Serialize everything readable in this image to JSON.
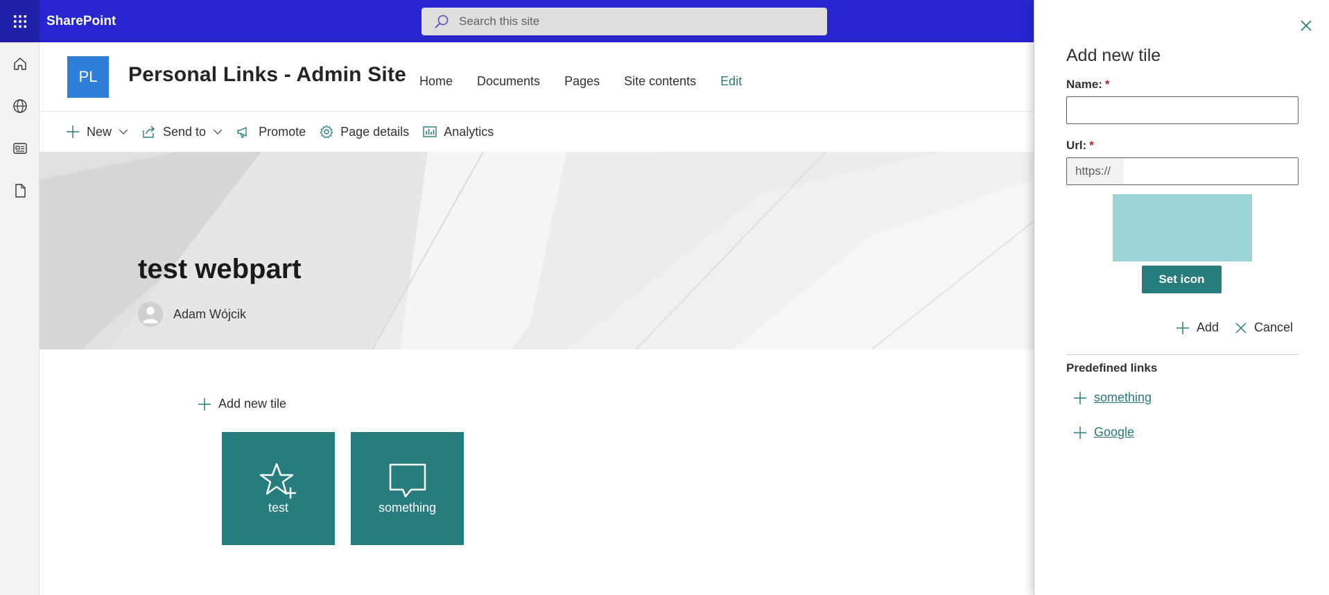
{
  "suitebar": {
    "brand": "SharePoint",
    "search_placeholder": "Search this site"
  },
  "site": {
    "logo_initials": "PL",
    "title": "Personal Links - Admin Site",
    "nav": [
      "Home",
      "Documents",
      "Pages",
      "Site contents",
      "Edit"
    ]
  },
  "commandbar": {
    "new": "New",
    "send_to": "Send to",
    "promote": "Promote",
    "page_details": "Page details",
    "analytics": "Analytics"
  },
  "hero": {
    "page_title": "test webpart",
    "author": "Adam Wójcik"
  },
  "content": {
    "add_tile": "Add new tile",
    "tiles": [
      {
        "label": "test",
        "icon": "star-add-icon"
      },
      {
        "label": "something",
        "icon": "comment-icon"
      }
    ]
  },
  "panel": {
    "title": "Add new tile",
    "name_label": "Name:",
    "url_label": "Url:",
    "required_marker": "*",
    "name_value": "",
    "url_prefix": "https://",
    "url_value": "",
    "preview_color": "#9bd5d8",
    "set_icon": "Set icon",
    "add": "Add",
    "cancel": "Cancel",
    "predefined_heading": "Predefined links",
    "predefined": [
      "something",
      "Google"
    ]
  },
  "colors": {
    "suitebar": "#2826d1",
    "accent": "#277d7e",
    "link": "#2b7a78",
    "logo": "#2e7fd9"
  }
}
